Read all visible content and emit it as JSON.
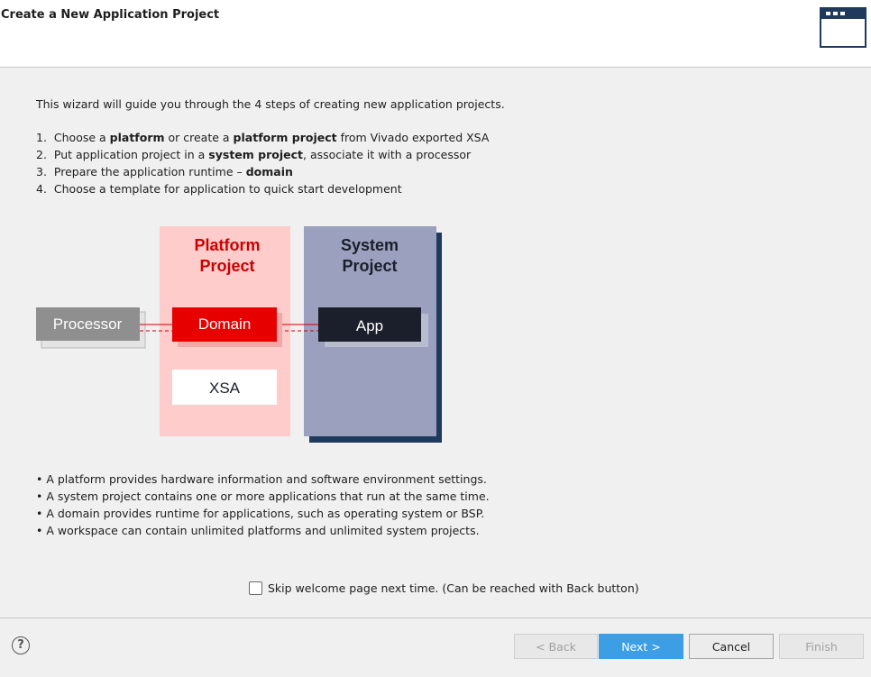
{
  "header": {
    "title": "Create a New Application Project"
  },
  "intro": "This wizard will guide you through the 4 steps of creating new application projects.",
  "steps": [
    {
      "num": "1.",
      "parts": [
        "Choose a ",
        "platform",
        " or create a ",
        "platform project",
        " from Vivado exported XSA"
      ]
    },
    {
      "num": "2.",
      "parts": [
        "Put application project in a ",
        "system project",
        ", associate it with a processor"
      ]
    },
    {
      "num": "3.",
      "parts": [
        "Prepare the application runtime – ",
        "domain",
        ""
      ]
    },
    {
      "num": "4.",
      "parts": [
        "Choose a template for application to quick start development"
      ]
    }
  ],
  "diagram": {
    "platform_title_line1": "Platform",
    "platform_title_line2": "Project",
    "system_title_line1": "System",
    "system_title_line2": "Project",
    "processor": "Processor",
    "domain": "Domain",
    "app": "App",
    "xsa": "XSA",
    "colors": {
      "platform_bg": "#ffcccc",
      "platform_title": "#cc0000",
      "domain": "#e60000",
      "system_bg": "#9aa0bd",
      "system_shadow": "#1f3a5c",
      "app": "#1b1e2b",
      "processor": "#8f8f8f"
    }
  },
  "bullets": [
    "• A platform provides hardware information and software environment settings.",
    "• A system project contains one or more applications that run at the same time.",
    "• A domain provides runtime for applications, such as operating system or BSP.",
    "• A workspace can contain unlimited platforms and unlimited system projects."
  ],
  "skip_label": "Skip welcome page next time. (Can be reached with Back button)",
  "skip_checked": false,
  "buttons": {
    "back": "< Back",
    "next": "Next >",
    "cancel": "Cancel",
    "finish": "Finish"
  },
  "help_glyph": "?"
}
